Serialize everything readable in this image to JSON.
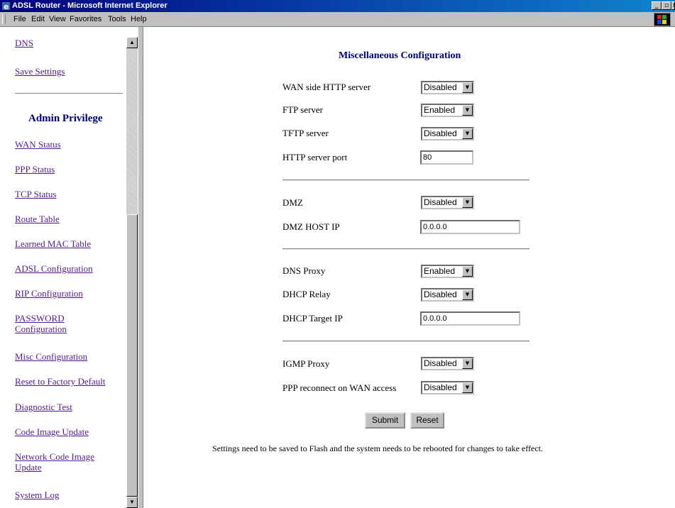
{
  "window": {
    "title": "ADSL Router - Microsoft Internet Explorer"
  },
  "menu": {
    "file": "File",
    "edit": "Edit",
    "view": "View",
    "favorites": "Favorites",
    "tools": "Tools",
    "help": "Help"
  },
  "nav": {
    "dns": "DNS",
    "save_settings": "Save Settings",
    "admin_heading": "Admin Privilege",
    "wan_status": "WAN Status",
    "ppp_status": "PPP Status",
    "tcp_status": "TCP Status",
    "route_table": "Route Table",
    "learned_mac_table": "Learned MAC Table",
    "adsl_configuration": "ADSL Configuration",
    "rip_configuration": "RIP Configuration",
    "password_configuration_1": "PASSWORD",
    "password_configuration_2": "Configuration",
    "misc_configuration": "Misc Configuration",
    "reset_factory": "Reset to Factory Default",
    "diagnostic_test": "Diagnostic Test",
    "code_image_update": "Code Image Update",
    "network_code_image_update_1": "Network Code Image",
    "network_code_image_update_2": "Update",
    "system_log": "System Log"
  },
  "main": {
    "title": "Miscellaneous Configuration",
    "fields": {
      "wan_http": {
        "label": "WAN side HTTP server",
        "value": "Disabled"
      },
      "ftp": {
        "label": "FTP server",
        "value": "Enabled"
      },
      "tftp": {
        "label": "TFTP server",
        "value": "Disabled"
      },
      "http_port": {
        "label": "HTTP server port",
        "value": "80"
      },
      "dmz": {
        "label": "DMZ",
        "value": "Disabled"
      },
      "dmz_host_ip": {
        "label": "DMZ HOST IP",
        "value": "0.0.0.0"
      },
      "dns_proxy": {
        "label": "DNS Proxy",
        "value": "Enabled"
      },
      "dhcp_relay": {
        "label": "DHCP Relay",
        "value": "Disabled"
      },
      "dhcp_target_ip": {
        "label": "DHCP Target IP",
        "value": "0.0.0.0"
      },
      "igmp_proxy": {
        "label": "IGMP Proxy",
        "value": "Disabled"
      },
      "ppp_reconnect": {
        "label": "PPP reconnect on WAN access",
        "value": "Disabled"
      }
    },
    "submit_label": "Submit",
    "reset_label": "Reset",
    "footnote": "Settings need to be saved to Flash and the system needs to be rebooted for changes to take effect."
  }
}
